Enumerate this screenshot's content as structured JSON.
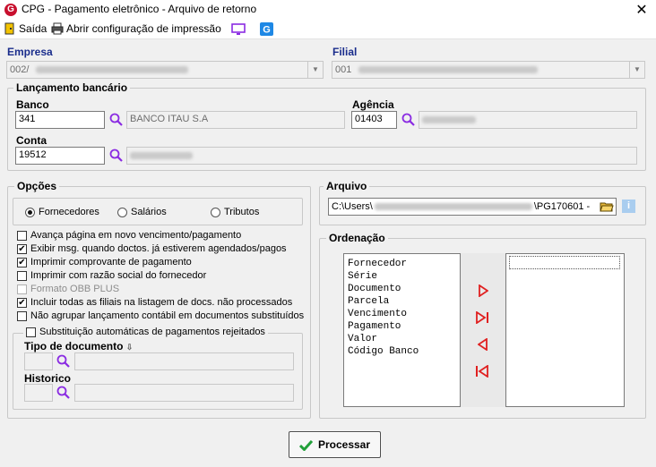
{
  "window": {
    "title": "CPG - Pagamento eletrônico - Arquivo de retorno",
    "app_icon_letter": "G"
  },
  "toolbar": {
    "exit_label": "Saída",
    "print_config_label": "Abrir configuração de impressão"
  },
  "empresa": {
    "label": "Empresa",
    "value": "002/"
  },
  "filial": {
    "label": "Filial",
    "value": "001"
  },
  "lancamento": {
    "title": "Lançamento bancário",
    "banco_label": "Banco",
    "banco_code": "341",
    "banco_name": "BANCO ITAU S.A",
    "agencia_label": "Agência",
    "agencia_code": "01403",
    "conta_label": "Conta",
    "conta_code": "19512"
  },
  "opcoes": {
    "title": "Opções",
    "radios": [
      {
        "label": "Fornecedores",
        "selected": true
      },
      {
        "label": "Salários",
        "selected": false
      },
      {
        "label": "Tributos",
        "selected": false
      }
    ],
    "checks": [
      {
        "label": "Avança página em novo vencimento/pagamento",
        "checked": false,
        "disabled": false
      },
      {
        "label": "Exibir msg. quando doctos. já estiverem agendados/pagos",
        "checked": true,
        "disabled": false
      },
      {
        "label": "Imprimir comprovante de pagamento",
        "checked": true,
        "disabled": false
      },
      {
        "label": "Imprimir com razão social do fornecedor",
        "checked": false,
        "disabled": false
      },
      {
        "label": "Formato OBB PLUS",
        "checked": false,
        "disabled": true
      },
      {
        "label": "Incluir todas as filiais na listagem de docs. não processados",
        "checked": true,
        "disabled": false
      },
      {
        "label": "Não agrupar lançamento contábil em documentos substituídos",
        "checked": false,
        "disabled": false
      }
    ],
    "subst_label": "Substituição automáticas de pagamentos rejeitados",
    "tipo_doc_label": "Tipo de documento",
    "historico_label": "Historico"
  },
  "arquivo": {
    "title": "Arquivo",
    "path_start": "C:\\Users\\",
    "path_end": "\\PG170601 -"
  },
  "ordenacao": {
    "title": "Ordenação",
    "items": [
      "Fornecedor",
      "Série",
      "Documento",
      "Parcela",
      "Vencimento",
      "Pagamento",
      "Valor",
      "Código Banco"
    ]
  },
  "footer": {
    "process_label": "Processar"
  },
  "colors": {
    "label_blue": "#1a2d8c",
    "arrow_red": "#e02020",
    "check_green": "#22a03a"
  }
}
